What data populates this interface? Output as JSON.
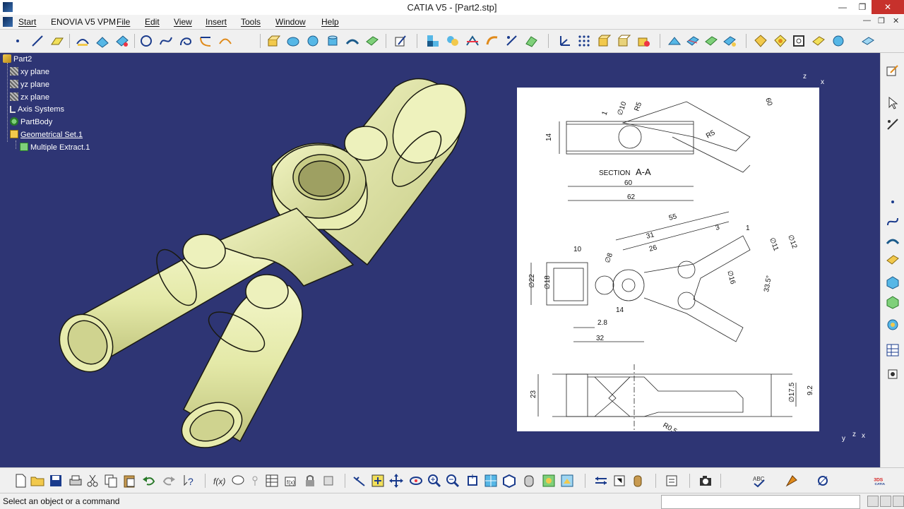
{
  "window": {
    "title": "CATIA V5 - [Part2.stp]",
    "minimize": "—",
    "maximize": "❐",
    "close": "✕"
  },
  "menu": {
    "items": [
      "Start",
      "ENOVIA V5 VPM",
      "File",
      "Edit",
      "View",
      "Insert",
      "Tools",
      "Window",
      "Help"
    ]
  },
  "tree": {
    "root": "Part2",
    "nodes": [
      "xy plane",
      "yz plane",
      "zx plane",
      "Axis Systems",
      "PartBody",
      "Geometrical Set.1",
      "Multiple Extract.1"
    ]
  },
  "status": {
    "message": "Select an object or a command",
    "command_value": ""
  },
  "compass_top": {
    "z": "z",
    "x": "x"
  },
  "compass_bottom": {
    "y": "y",
    "z": "z",
    "x": "x"
  },
  "drawing": {
    "section_label": "SECTION",
    "section_letters": "A-A",
    "section_view": {
      "dim_left": "14",
      "dim_60": "60",
      "dim_62": "62",
      "r5a": "R5",
      "r5b": "R5",
      "dia10": "∅10",
      "one": "1",
      "dim_top_right": "60"
    },
    "plan_view": {
      "d55": "55",
      "d31": "31",
      "d26": "26",
      "d10": "10",
      "d8": "∅8",
      "d22": "∅22",
      "d18": "∅18",
      "d14": "14",
      "d2_8": "2.8",
      "d32": "32",
      "d3": "3",
      "d12": "∅12",
      "d11": "∅11",
      "d16": "∅16",
      "angle": "33.5°",
      "one": "1"
    },
    "side_view": {
      "d23": "23",
      "d17_5": "∅17.5",
      "d9_2": "9.2",
      "r0_5": "R0.5"
    }
  },
  "colors": {
    "viewport": "#2e3574",
    "part": "#e8edb0",
    "part_shade": "#c9cf88"
  }
}
